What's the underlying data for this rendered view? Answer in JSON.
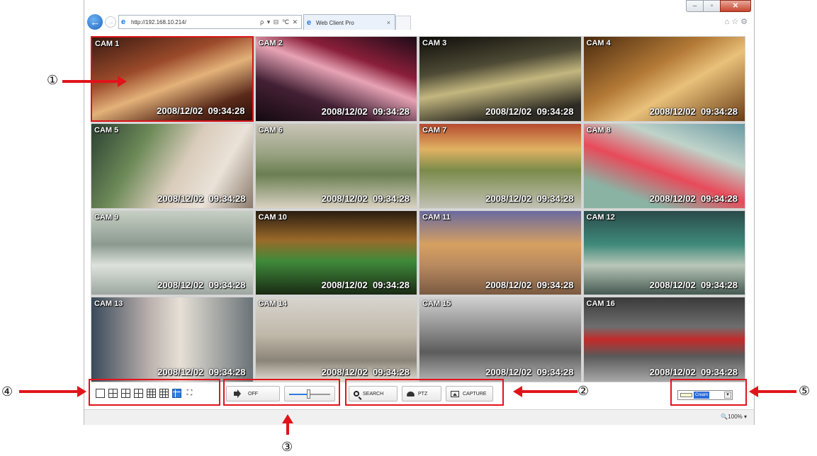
{
  "browser": {
    "url": "http://192.168.10.214/",
    "address_tools": "ρ ▾ ⊟ ℃ ✕",
    "tab_title": "Web Client Pro",
    "tab_close": "×",
    "right_icons": "⌂☆⚙",
    "window_controls": {
      "minimize": "–",
      "maximize": "▫",
      "close": "✕"
    },
    "zoom": "🔍100%  ▾"
  },
  "cameras": [
    {
      "title": "CAM 1",
      "time": "2008/12/02  09:34:28",
      "selected": true
    },
    {
      "title": "CAM 2",
      "time": "2008/12/02  09:34:28"
    },
    {
      "title": "CAM 3",
      "time": "2008/12/02  09:34:28"
    },
    {
      "title": "CAM 4",
      "time": "2008/12/02  09:34:28"
    },
    {
      "title": "CAM 5",
      "time": "2008/12/02  09:34:28"
    },
    {
      "title": "CAM 6",
      "time": "2008/12/02  09:34:28"
    },
    {
      "title": "CAM 7",
      "time": "2008/12/02  09:34:28"
    },
    {
      "title": "CAM 8",
      "time": "2008/12/02  09:34:28"
    },
    {
      "title": "CAM 9",
      "time": "2008/12/02  09:34:28"
    },
    {
      "title": "CAM 10",
      "time": "2008/12/02  09:34:28"
    },
    {
      "title": "CAM 11",
      "time": "2008/12/02  09:34:28"
    },
    {
      "title": "CAM 12",
      "time": "2008/12/02  09:34:28"
    },
    {
      "title": "CAM 13",
      "time": "2008/12/02  09:34:28"
    },
    {
      "title": "CAM 14",
      "time": "2008/12/02  09:34:28"
    },
    {
      "title": "CAM 15",
      "time": "2008/12/02  09:34:28"
    },
    {
      "title": "CAM 16",
      "time": "2008/12/02  09:34:28"
    }
  ],
  "toolbar": {
    "layout_icons": [
      "single-view-icon",
      "quad-view-icon",
      "six-view-icon",
      "eight-view-icon",
      "nine-view-icon",
      "thirteen-view-icon",
      "sixteen-view-icon",
      "fullscreen-icon"
    ],
    "active_layout": "sixteen-view-icon",
    "fullscreen_glyph": "⛶",
    "audio_label": "OFF",
    "volume_level": 0.45,
    "search_label": "SEARCH",
    "ptz_label": "PTZ",
    "capture_label": "CAPTURE",
    "color_value": "Cream",
    "color_swatch": "#fffdd0",
    "dropdown_glyph": "▾"
  },
  "annotations": {
    "one": "①",
    "two": "②",
    "three": "③",
    "four": "④",
    "five": "⑤",
    "color": "#e0141a"
  }
}
